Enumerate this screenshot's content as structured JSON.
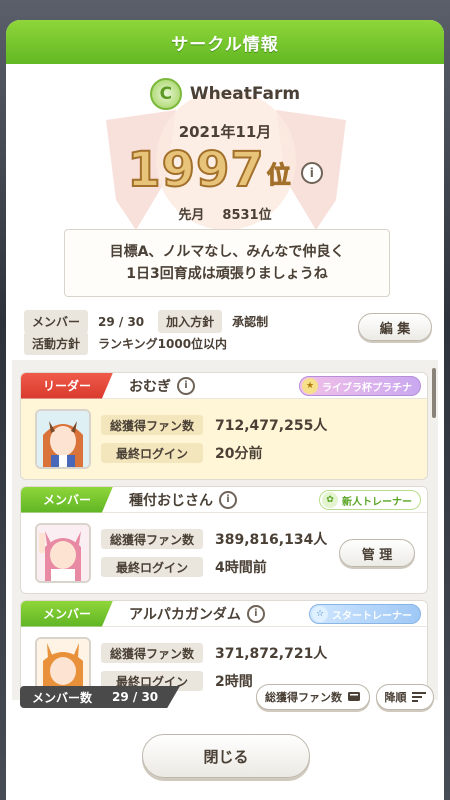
{
  "dialog": {
    "title": "サークル情報"
  },
  "club": {
    "name": "WheatFarm",
    "logo_letter": "C",
    "month": "2021年11月",
    "rank": "1997",
    "rank_suffix": "位",
    "last_month_label": "先月",
    "last_month_rank": "8531位",
    "motto_line1": "目標A、ノルマなし、みんなで仲良く",
    "motto_line2": "1日3回育成は頑張りましょうね",
    "member_label": "メンバー",
    "member_value": "29 / 30",
    "join_policy_label": "加入方針",
    "join_policy_value": "承認制",
    "activity_label": "活動方針",
    "activity_value": "ランキング1000位以内",
    "edit_label": "編 集"
  },
  "stats_labels": {
    "fans": "総獲得ファン数",
    "login": "最終ログイン"
  },
  "members": [
    {
      "role": "リーダー",
      "name": "おむぎ",
      "badge": "ライブラ杯プラチナ",
      "fans": "712,477,255人",
      "login": "20分前"
    },
    {
      "role": "メンバー",
      "name": "種付おじさん",
      "badge": "新人トレーナー",
      "fans": "389,816,134人",
      "login": "4時間前",
      "action": "管 理"
    },
    {
      "role": "メンバー",
      "name": "アルパカガンダム",
      "badge": "スタートレーナー",
      "fans": "371,872,721人",
      "login": "2時間"
    }
  ],
  "bottom": {
    "count_label": "メンバー数",
    "count_value": "29 / 30",
    "sort_label": "総獲得ファン数",
    "order_label": "降順"
  },
  "close_label": "閉じる",
  "colors": {
    "header_green": "#7cc82e",
    "leader_red": "#e4473a",
    "rank_gold": "#e8c47a"
  }
}
